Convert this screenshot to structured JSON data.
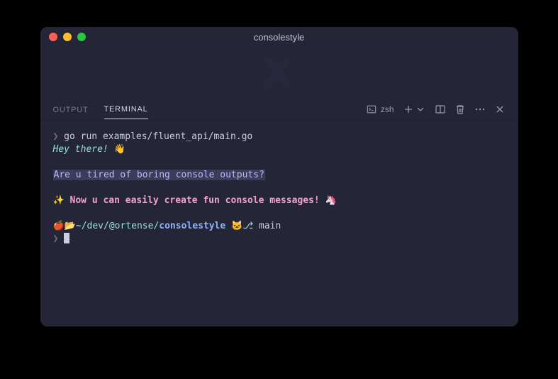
{
  "window": {
    "title": "consolestyle"
  },
  "tabs": {
    "output": "OUTPUT",
    "terminal": "TERMINAL"
  },
  "toolbar": {
    "shell": "zsh"
  },
  "terminal": {
    "prompt1": "❯",
    "cmd1": " go run examples/fluent_api/main.go",
    "greeting": "Hey there! ",
    "wave": "👋",
    "question": "Are u tired of boring console outputs?",
    "sparkle": "✨ ",
    "funmsg": "Now u can easily create fun console messages!",
    "unicorn": " 🦄",
    "apple": "🍎",
    "folder": "📂",
    "path1": "~/dev/@ortense/",
    "repo": "consolestyle",
    "branch_icon": " 🐱",
    "branch_sym": "⎇ ",
    "branch": "main",
    "prompt2": "❯ "
  }
}
